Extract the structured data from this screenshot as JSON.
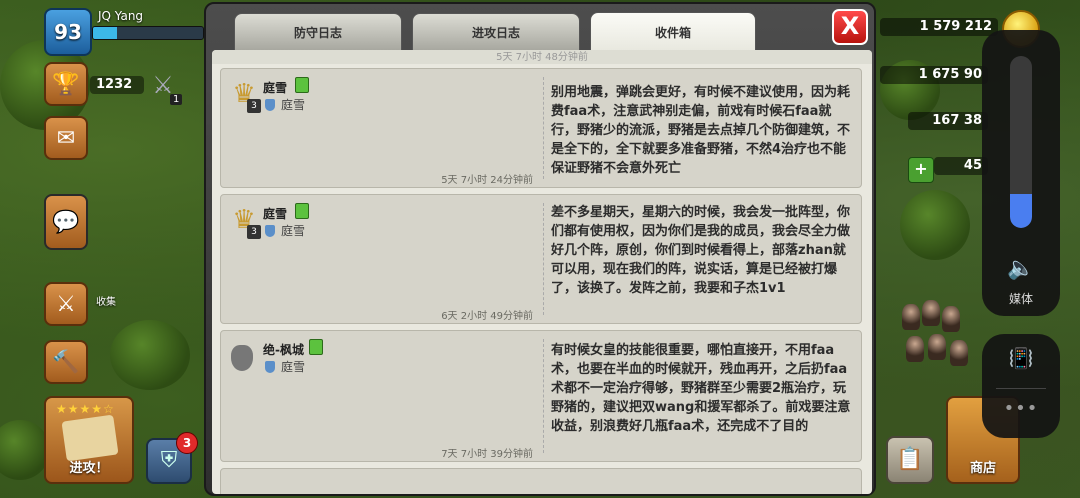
{
  "hud": {
    "level": "93",
    "player_name": "JQ Yang",
    "xp_progress": 0.22,
    "trophies": "1232",
    "league_number": "1",
    "collect_label": "收集",
    "attack_label": "进攻！",
    "attack_stars": "★★★★☆",
    "notification_count": "3",
    "gold": "1 579 212",
    "elixir": "1 675 90",
    "dark_elixir": "167 38",
    "gems": "45",
    "shop_label": "商店"
  },
  "volume": {
    "level": 0.2,
    "label": "媒体"
  },
  "dialog": {
    "tabs": [
      {
        "label": "防守日志",
        "active": false
      },
      {
        "label": "进攻日志",
        "active": false
      },
      {
        "label": "收件箱",
        "active": true
      }
    ],
    "close_label": "X",
    "scroll_top_text": "5天 7小时 48分钟前"
  },
  "messages": [
    {
      "sender": "庭雪",
      "sender_level": "3",
      "clan": "庭雪",
      "avatar": "league-badge",
      "text": "别用地震，弹跳会更好，有时候不建议使用，因为耗费faa术，注意武神别走偏，前戏有时候石faa就行，野猪少的流派，野猪是去点掉几个防御建筑，不是全下的，全下就要多准备野猪，不然4治疗也不能保证野猪不会意外死亡",
      "time": "5天 7小时 24分钟前"
    },
    {
      "sender": "庭雪",
      "sender_level": "3",
      "clan": "庭雪",
      "avatar": "league-badge",
      "text": "差不多星期天，星期六的时候，我会发一批阵型，你们都有使用权，因为你们是我的成员，我会尽全力做好几个阵，原创，你们到时候看得上，部落zhan就可以用，现在我们的阵，说实话，算是已经被打爆了，该换了。发阵之前，我要和子杰1v1",
      "time": "6天 2小时 49分钟前"
    },
    {
      "sender": "绝-枫城",
      "sender_level": "",
      "clan": "庭雪",
      "avatar": "unranked-shield",
      "text": "有时候女皇的技能很重要，哪怕直接开，不用faa术，也要在半血的时候就开，残血再开，之后扔faa术都不一定治疗得够，野猪群至少需要2瓶治疗，玩野猪的，建议把双wang和援军都杀了。前戏要注意收益，别浪费好几瓶faa术，还完成不了目的",
      "time": "7天 7小时 39分钟前"
    }
  ]
}
